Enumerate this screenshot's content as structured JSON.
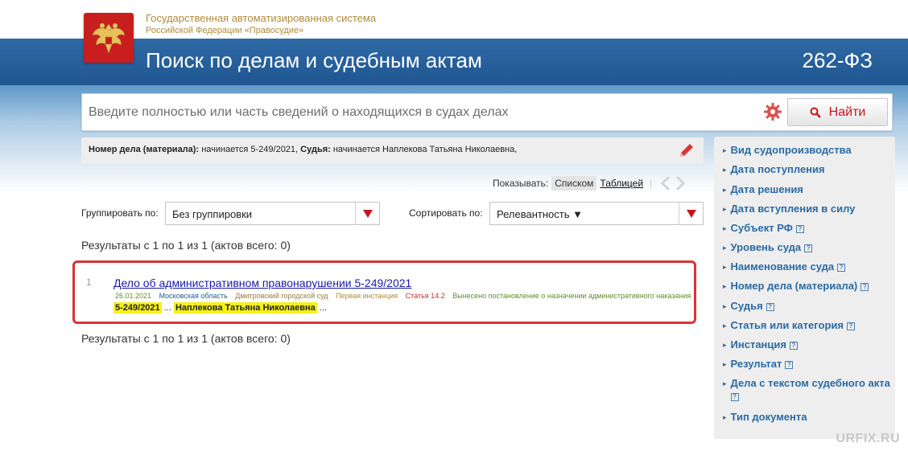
{
  "header": {
    "system_line1": "Государственная автоматизированная система",
    "system_line2": "Российской Федерации «Правосудие»",
    "title": "Поиск по делам и судебным актам",
    "law": "262-ФЗ"
  },
  "search": {
    "placeholder": "Введите полностью или часть сведений о находящихся в судах делах",
    "value": "",
    "button_label": "Найти"
  },
  "criteria": {
    "case_label": "Номер дела (материала):",
    "case_value": "начинается 5-249/2021,",
    "judge_label": "Судья:",
    "judge_value": "начинается Наплекова Татьяна Николаевна,"
  },
  "view": {
    "label": "Показывать:",
    "list": "Списком",
    "table": "Таблицей"
  },
  "grouping": {
    "label": "Группировать по:",
    "value": "Без группировки"
  },
  "sorting": {
    "label": "Сортировать по:",
    "value": "Релевантность ▼"
  },
  "results_count": "Результаты с 1 по 1 из 1 (актов всего: 0)",
  "results": [
    {
      "number": "1",
      "title": "Дело об административном правонарушении 5-249/2021",
      "date": "26.01.2021",
      "region": "Московская область",
      "court": "Дмитровский городской суд",
      "instance": "Первая инстанция",
      "article": "Статья 14.2",
      "outcome": "Вынесено постановление о назначении административного наказания",
      "hl_case": "5-249/2021",
      "hl_judge": "Наплекова Татьяна Николаевна",
      "ellipsis": "..."
    }
  ],
  "sidebar": {
    "items": [
      {
        "label": "Вид судопроизводства",
        "help": false
      },
      {
        "label": "Дата поступления",
        "help": false
      },
      {
        "label": "Дата решения",
        "help": false
      },
      {
        "label": "Дата вступления в силу",
        "help": false
      },
      {
        "label": "Субъект РФ",
        "help": true
      },
      {
        "label": "Уровень суда",
        "help": true
      },
      {
        "label": "Наименование суда",
        "help": true
      },
      {
        "label": "Номер дела (материала)",
        "help": true
      },
      {
        "label": "Судья",
        "help": true
      },
      {
        "label": "Статья или категория",
        "help": true
      },
      {
        "label": "Инстанция",
        "help": true
      },
      {
        "label": "Результат",
        "help": true
      },
      {
        "label": "Дела с текстом судебного акта",
        "help": true
      },
      {
        "label": "Тип документа",
        "help": false
      }
    ],
    "help_glyph": "?"
  },
  "watermark": "URFIX.RU",
  "colors": {
    "title_bar": "#1f5690",
    "accent_red": "#c4161c",
    "link": "#2b6aa3",
    "highlight": "#f6f01c",
    "card_border": "#d8343a"
  }
}
